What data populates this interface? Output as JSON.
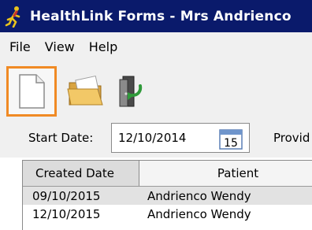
{
  "window": {
    "title": "HealthLink Forms - Mrs Andrienco",
    "icon": "runner-icon"
  },
  "menu": {
    "items": [
      "File",
      "View",
      "Help"
    ]
  },
  "toolbar": {
    "buttons": [
      {
        "icon": "new-document-icon"
      },
      {
        "icon": "open-folder-icon"
      },
      {
        "icon": "exit-door-icon"
      }
    ]
  },
  "filter": {
    "start_date_label": "Start Date:",
    "start_date_value": "12/10/2014",
    "calendar_icon_text": "15",
    "provider_label": "Provid"
  },
  "grid": {
    "columns": [
      "Created Date",
      "Patient"
    ],
    "rows": [
      {
        "created": "09/10/2015",
        "patient": "Andrienco Wendy"
      },
      {
        "created": "12/10/2015",
        "patient": "Andrienco Wendy"
      }
    ]
  },
  "colors": {
    "titlebar": "#0a1a6b",
    "highlight": "#f08a24",
    "selected_row": "#e2e2e2"
  }
}
